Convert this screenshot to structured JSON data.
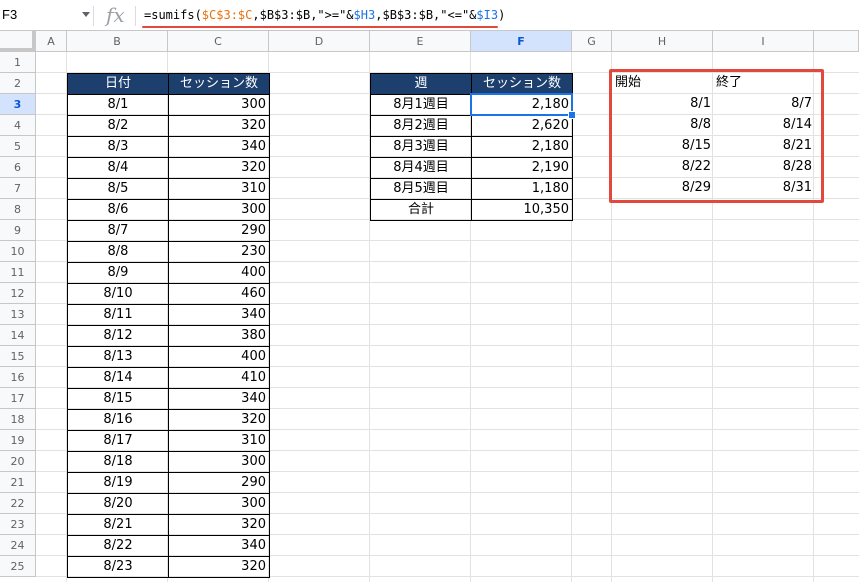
{
  "name_box": "F3",
  "fx_label": "fx",
  "formula": {
    "p1": "=sumifs(",
    "p2": "$C$3:$C",
    "p3": ",",
    "p4": "$B$3:$B",
    "p5": ",\">=\"&",
    "p6": "$H3",
    "p7": ",",
    "p8": "$B$3:$B",
    "p9": ",\"<=\"&",
    "p10": "$I3",
    "p11": ")"
  },
  "columns": [
    "A",
    "B",
    "C",
    "D",
    "E",
    "F",
    "G",
    "H",
    "I"
  ],
  "rows": [
    "1",
    "2",
    "3",
    "4",
    "5",
    "6",
    "7",
    "8",
    "9",
    "10",
    "11",
    "12",
    "13",
    "14",
    "15",
    "16",
    "17",
    "18",
    "19",
    "20",
    "21",
    "22",
    "23",
    "24",
    "25"
  ],
  "daily_table": {
    "headers": [
      "日付",
      "セッション数"
    ],
    "rows": [
      [
        "8/1",
        "300"
      ],
      [
        "8/2",
        "320"
      ],
      [
        "8/3",
        "340"
      ],
      [
        "8/4",
        "320"
      ],
      [
        "8/5",
        "310"
      ],
      [
        "8/6",
        "300"
      ],
      [
        "8/7",
        "290"
      ],
      [
        "8/8",
        "230"
      ],
      [
        "8/9",
        "400"
      ],
      [
        "8/10",
        "460"
      ],
      [
        "8/11",
        "340"
      ],
      [
        "8/12",
        "380"
      ],
      [
        "8/13",
        "400"
      ],
      [
        "8/14",
        "410"
      ],
      [
        "8/15",
        "340"
      ],
      [
        "8/16",
        "320"
      ],
      [
        "8/17",
        "310"
      ],
      [
        "8/18",
        "300"
      ],
      [
        "8/19",
        "290"
      ],
      [
        "8/20",
        "300"
      ],
      [
        "8/21",
        "320"
      ],
      [
        "8/22",
        "340"
      ],
      [
        "8/23",
        "320"
      ]
    ]
  },
  "weekly_table": {
    "headers": [
      "週",
      "セッション数"
    ],
    "rows": [
      [
        "8月1週目",
        "2,180"
      ],
      [
        "8月2週目",
        "2,620"
      ],
      [
        "8月3週目",
        "2,180"
      ],
      [
        "8月4週目",
        "2,190"
      ],
      [
        "8月5週目",
        "1,180"
      ]
    ],
    "total": [
      "合計",
      "10,350"
    ]
  },
  "range_table": {
    "headers": [
      "開始",
      "終了"
    ],
    "rows": [
      [
        "8/1",
        "8/7"
      ],
      [
        "8/8",
        "8/14"
      ],
      [
        "8/15",
        "8/21"
      ],
      [
        "8/22",
        "8/28"
      ],
      [
        "8/29",
        "8/31"
      ]
    ]
  },
  "colors": {
    "header_fill": "#1c3f6e",
    "selection": "#1a73e8",
    "annotation_red": "#e2483b",
    "ref_orange": "#e8710a",
    "ref_blue": "#1a73e8"
  },
  "icons": [
    "dropdown-arrow-icon",
    "fx-icon"
  ]
}
